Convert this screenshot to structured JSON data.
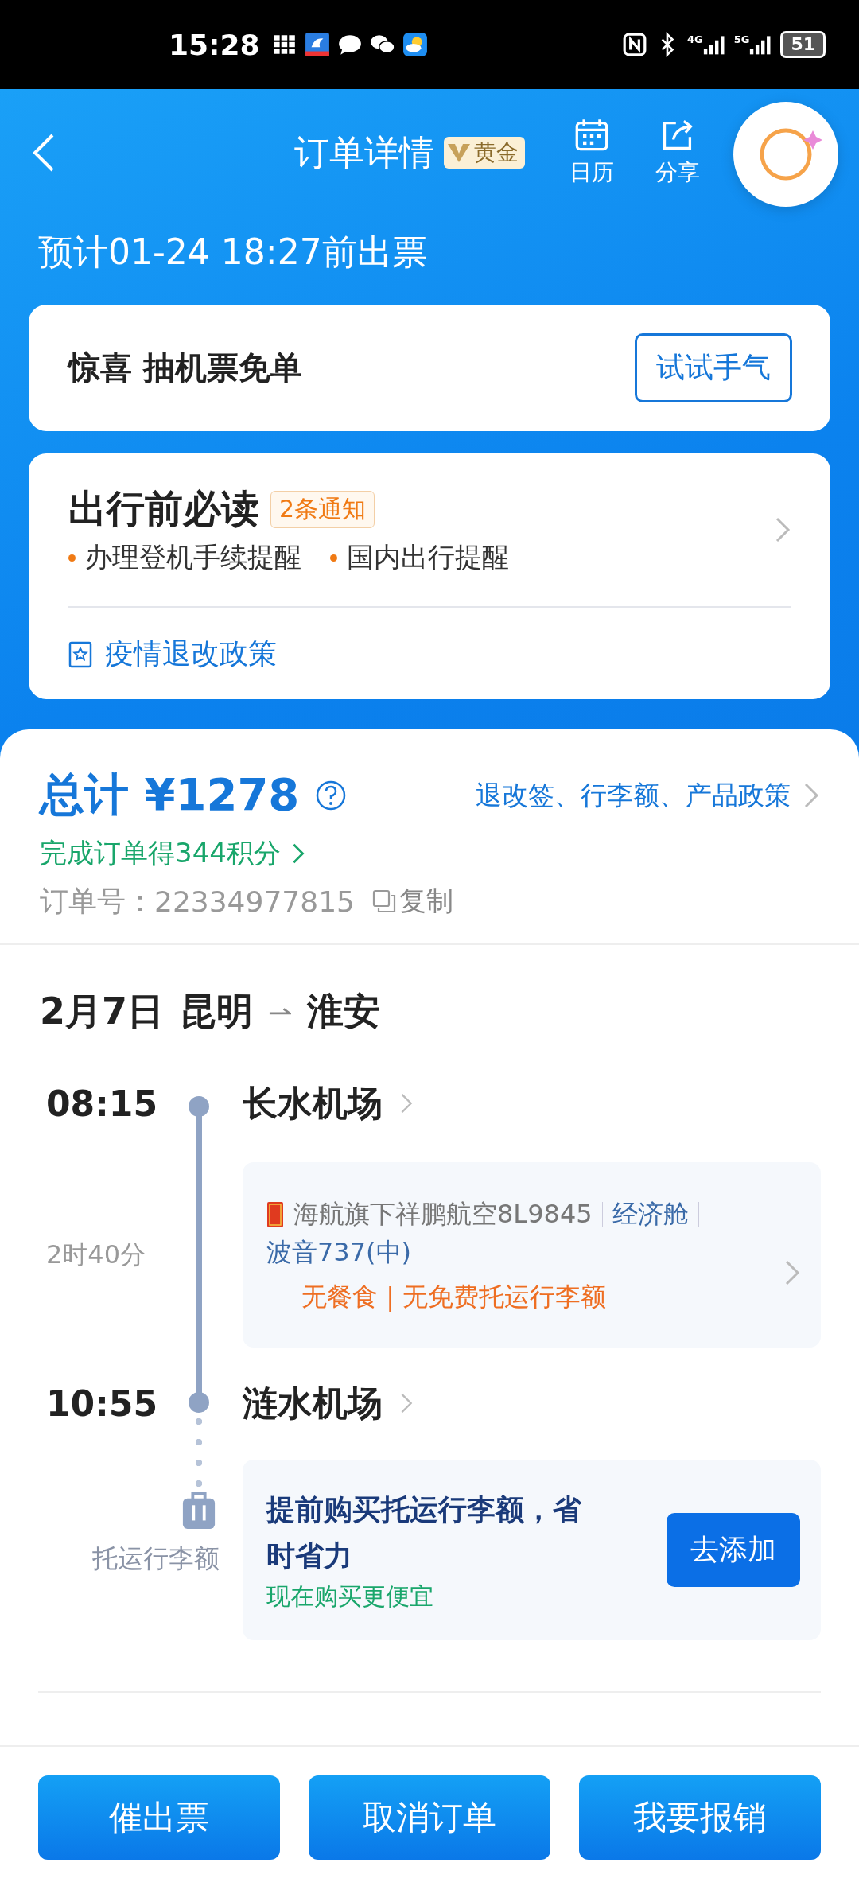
{
  "status_bar": {
    "time": "15:28",
    "networks": [
      "4G",
      "5G"
    ],
    "battery": "51"
  },
  "header": {
    "title": "订单详情",
    "badge": "黄金",
    "actions": [
      {
        "kind": "calendar",
        "label": "日历"
      },
      {
        "kind": "share",
        "label": "分享"
      }
    ]
  },
  "ticket_deadline": "预计01-24 18:27前出票",
  "promo": {
    "text": "惊喜 抽机票免单",
    "button": "试试手气"
  },
  "notice": {
    "title": "出行前必读",
    "badge": "2条通知",
    "items": [
      "办理登机手续提醒",
      "国内出行提醒"
    ],
    "link": "疫情退改政策"
  },
  "summary": {
    "total": "总计 ¥1278",
    "policy_link": "退改签、行李额、产品政策",
    "points": "完成订单得344积分",
    "order_label": "订单号：",
    "order_number": "22334977815",
    "copy": "复制"
  },
  "trip": {
    "date": "2月7日",
    "from": "昆明",
    "to": "淮安",
    "departure": {
      "time": "08:15",
      "airport": "长水机场"
    },
    "duration": "2时40分",
    "flight": {
      "airline": "海航旗下祥鹏航空8L9845",
      "cabin": "经济舱",
      "aircraft": "波音737(中)",
      "notes": "无餐食 | 无免费托运行李额"
    },
    "arrival": {
      "time": "10:55",
      "airport": "涟水机场"
    },
    "baggage": {
      "label": "托运行李额",
      "title": "提前购买托运行李额，省时省力",
      "subtitle": "现在购买更便宜",
      "button": "去添加"
    }
  },
  "bottom_buttons": [
    "催出票",
    "取消订单",
    "我要报销"
  ]
}
